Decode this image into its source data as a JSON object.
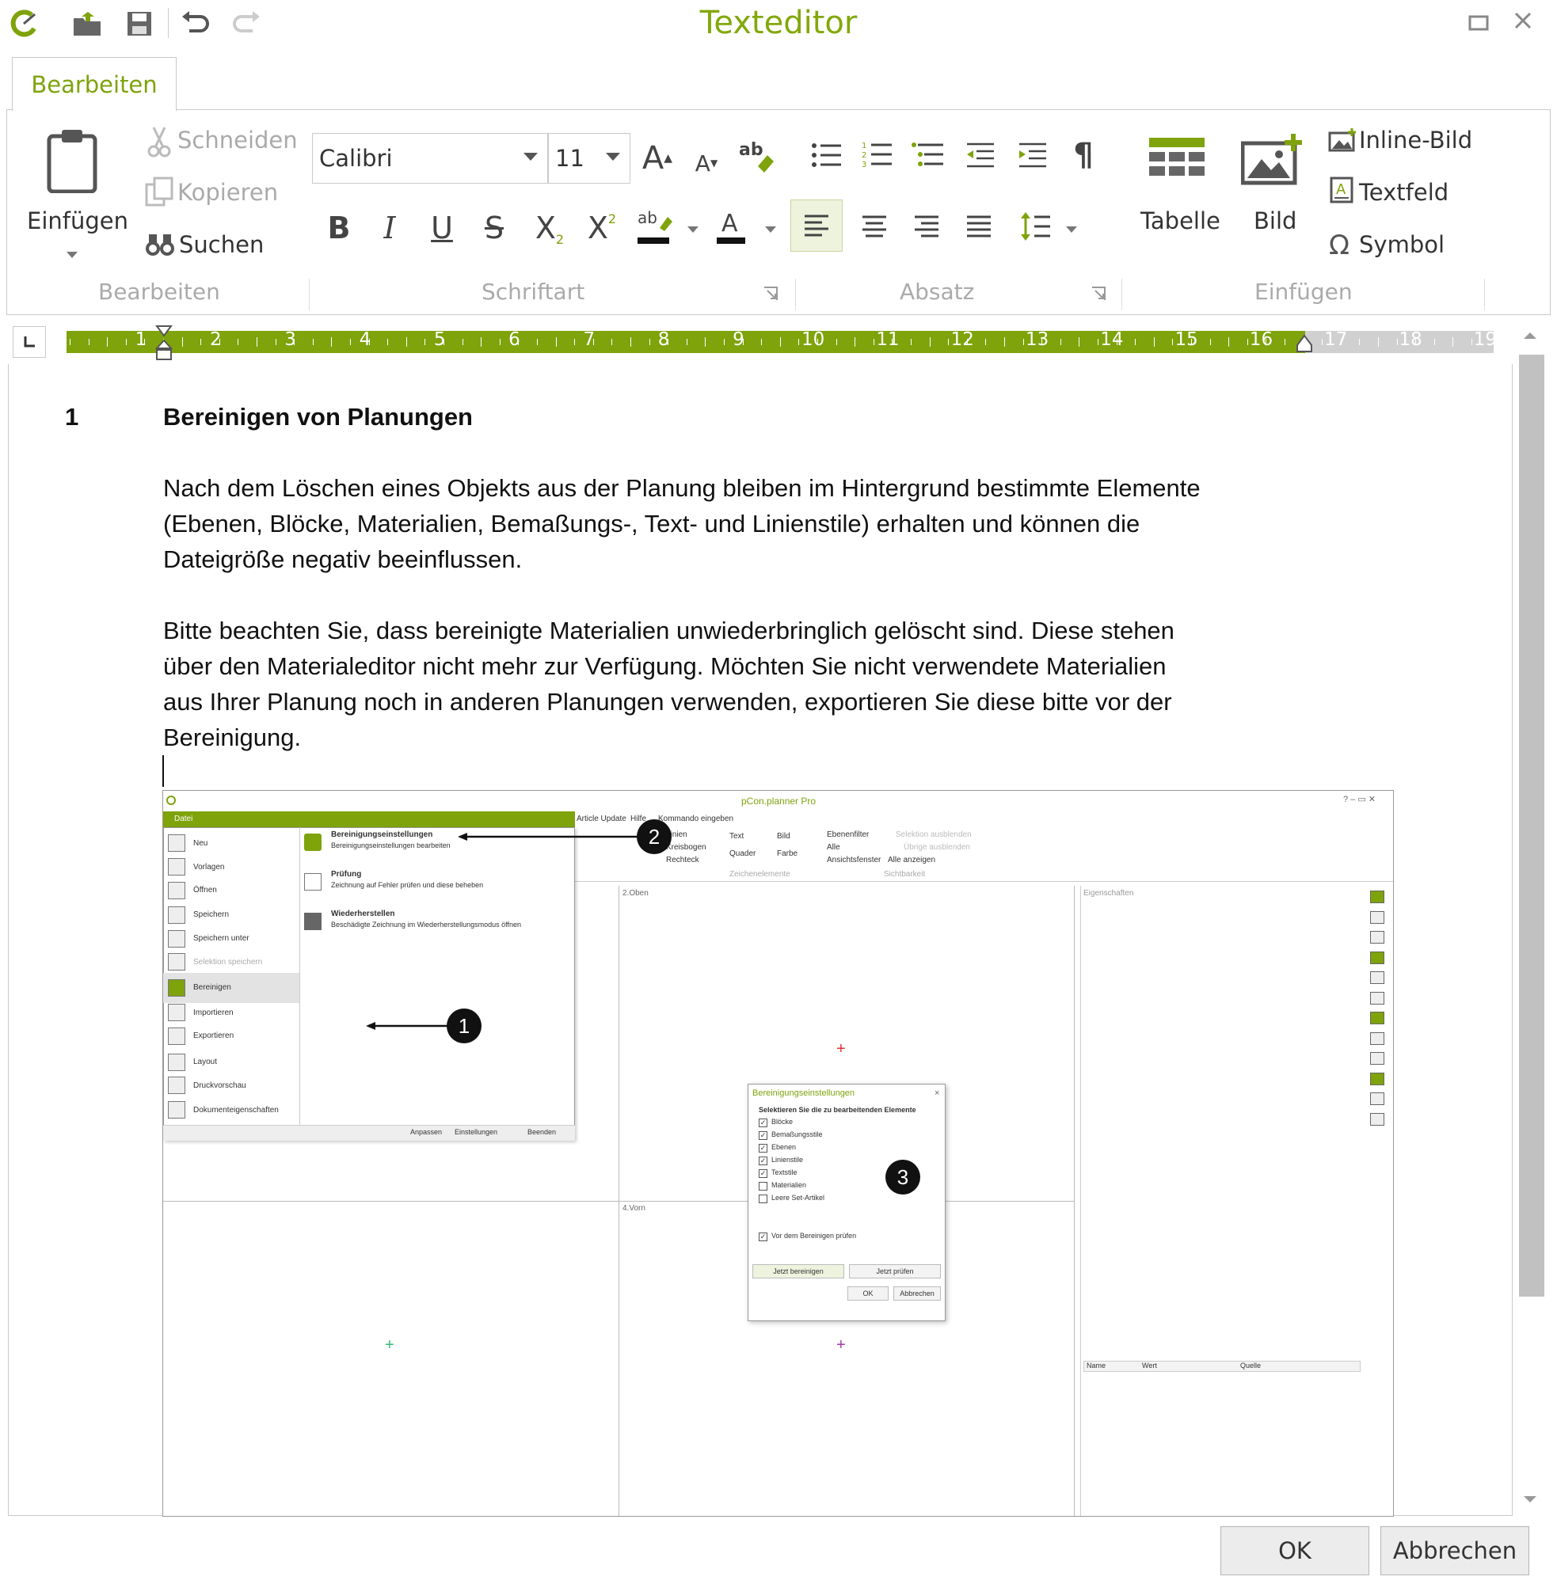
{
  "window": {
    "title": "Texteditor"
  },
  "tabs": [
    {
      "label": "Bearbeiten"
    }
  ],
  "ribbon": {
    "clipboard": {
      "paste": "Einfügen",
      "cut": "Schneiden",
      "copy": "Kopieren",
      "find": "Suchen",
      "group": "Bearbeiten"
    },
    "font": {
      "family": "Calibri",
      "size": "11",
      "group": "Schriftart",
      "grow": "A",
      "shrink": "A",
      "bold": "B",
      "italic": "I",
      "underline": "U",
      "strike": "S",
      "sub": "X",
      "sup": "X",
      "sub_index": "2",
      "sup_index": "2",
      "highlight": "ab",
      "color": "A"
    },
    "paragraph": {
      "group": "Absatz"
    },
    "insert": {
      "table": "Tabelle",
      "image": "Bild",
      "inline_image": "Inline-Bild",
      "textbox": "Textfeld",
      "symbol": "Symbol",
      "group": "Einfügen"
    }
  },
  "ruler": {
    "numbers": [
      "1",
      "2",
      "3",
      "4",
      "5",
      "6",
      "7",
      "8",
      "9",
      "10",
      "11",
      "12",
      "13",
      "14",
      "15",
      "16",
      "17",
      "18",
      "19"
    ]
  },
  "document": {
    "heading_number": "1",
    "heading": "Bereinigen von Planungen",
    "para1": [
      "Nach dem Löschen eines Objekts aus der Planung bleiben im Hintergrund bestimmte Elemente",
      "(Ebenen, Blöcke, Materialien, Bemaßungs-, Text- und Linienstile) erhalten und können die",
      "Dateigröße negativ beeinflussen."
    ],
    "para2": [
      "Bitte beachten Sie, dass bereinigte Materialien unwiederbringlich gelöscht sind. Diese stehen",
      "über den Materialeditor nicht mehr zur Verfügung. Möchten Sie nicht verwendete Materialien",
      "aus Ihrer Planung noch in anderen Planungen verwenden, exportieren Sie diese bitte vor der",
      "Bereinigung."
    ]
  },
  "screenshot": {
    "app_title": "pCon.planner Pro",
    "file_tab": "Datei",
    "menu": [
      "Neu",
      "Vorlagen",
      "Öffnen",
      "Speichern",
      "Speichern unter",
      "Selektion speichern",
      "Bereinigen",
      "Importieren",
      "Exportieren",
      "Layout",
      "Druckvorschau",
      "Dokumenteigenschaften"
    ],
    "submenu": [
      {
        "title": "Bereinigungseinstellungen",
        "desc": "Bereinigungseinstellungen bearbeiten"
      },
      {
        "title": "Prüfung",
        "desc": "Zeichnung auf Fehler prüfen und diese beheben"
      },
      {
        "title": "Wiederherstellen",
        "desc": "Beschädigte Zeichnung im Wiederherstellungsmodus öffnen"
      }
    ],
    "menu_footer": [
      "Anpassen",
      "Einstellungen",
      "Beenden"
    ],
    "ribbon_tabs": [
      "Article Update",
      "Hilfe",
      "Kommando eingeben"
    ],
    "ribbon_items": [
      "Linien",
      "Kreisbogen",
      "Rechteck",
      "Text",
      "Quader",
      "Bild",
      "Farbe",
      "Ebenenfilter",
      "Alle",
      "Ansichtsfenster",
      "Alle anzeigen",
      "Selektion ausblenden",
      "Übrige ausblenden",
      "Zeichenelemente",
      "Sichtbarkeit"
    ],
    "view_labels": [
      "2.Oben",
      "4.Vorn"
    ],
    "properties": {
      "title": "Eigenschaften",
      "cols": [
        "Name",
        "Wert",
        "Quelle"
      ]
    },
    "dialog": {
      "title": "Bereinigungseinstellungen",
      "subtitle": "Selektieren Sie die zu bearbeitenden Elemente",
      "items": [
        {
          "label": "Blöcke",
          "checked": true
        },
        {
          "label": "Bemaßungsstile",
          "checked": true
        },
        {
          "label": "Ebenen",
          "checked": true
        },
        {
          "label": "Linienstile",
          "checked": true
        },
        {
          "label": "Textstile",
          "checked": true
        },
        {
          "label": "Materialien",
          "checked": false
        },
        {
          "label": "Leere Set-Artikel",
          "checked": false
        }
      ],
      "check_before": "Vor dem Bereinigen prüfen",
      "btn_clean": "Jetzt bereinigen",
      "btn_check": "Jetzt prüfen",
      "btn_ok": "OK",
      "btn_cancel": "Abbrechen"
    },
    "callouts": [
      "1",
      "2",
      "3"
    ]
  },
  "footer": {
    "ok": "OK",
    "cancel": "Abbrechen"
  },
  "colors": {
    "accent": "#7ea30b"
  }
}
